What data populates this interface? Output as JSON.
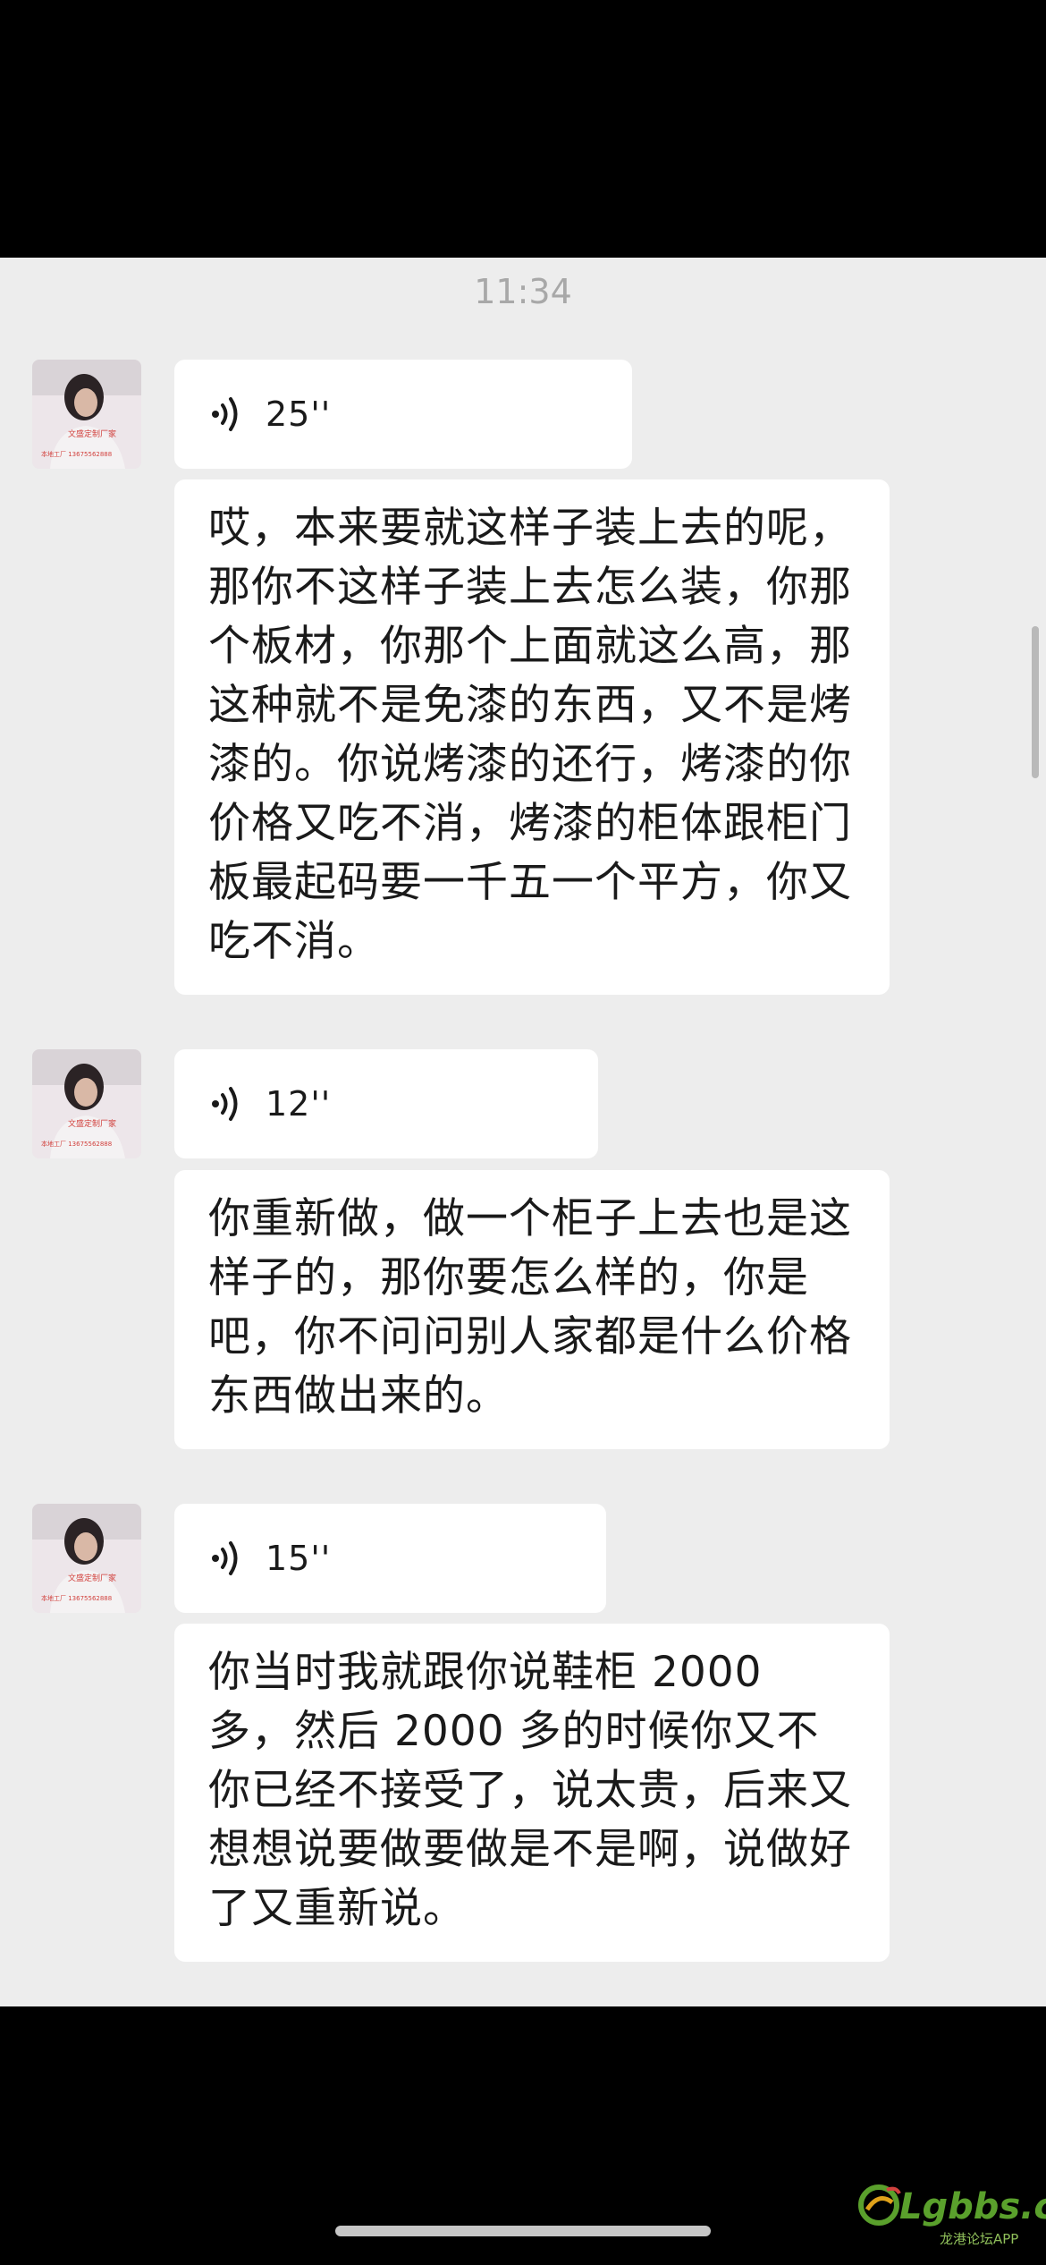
{
  "chat": {
    "timestamp": "11:34",
    "messages": [
      {
        "type": "voice",
        "duration": "25''"
      },
      {
        "type": "text",
        "text": "哎，本来要就这样子装上去的呢，那你不这样子装上去怎么装，你那个板材，你那个上面就这么高，那这种就不是免漆的东西，又不是烤漆的。你说烤漆的还行，烤漆的你价格又吃不消，烤漆的柜体跟柜门板最起码要一千五一个平方，你又吃不消。"
      },
      {
        "type": "voice",
        "duration": "12''"
      },
      {
        "type": "text",
        "text": "你重新做，做一个柜子上去也是这样子的，那你要怎么样的，你是吧，你不问问别人家都是什么价格东西做出来的。"
      },
      {
        "type": "voice",
        "duration": "15''"
      },
      {
        "type": "text",
        "text": "你当时我就跟你说鞋柜 2000 多，然后 2000 多的时候你又不你已经不接受了，说太贵，后来又想想说要做要做是不是啊，说做好了又重新说。"
      }
    ]
  },
  "avatar": {
    "caption": "文盛定制厂家",
    "phone": "本地工厂 13675562888"
  },
  "watermark": {
    "logo": "Lgbbs.cn",
    "sub": "龙港论坛APP"
  },
  "icons": {
    "voice": "voice-wave-icon"
  }
}
